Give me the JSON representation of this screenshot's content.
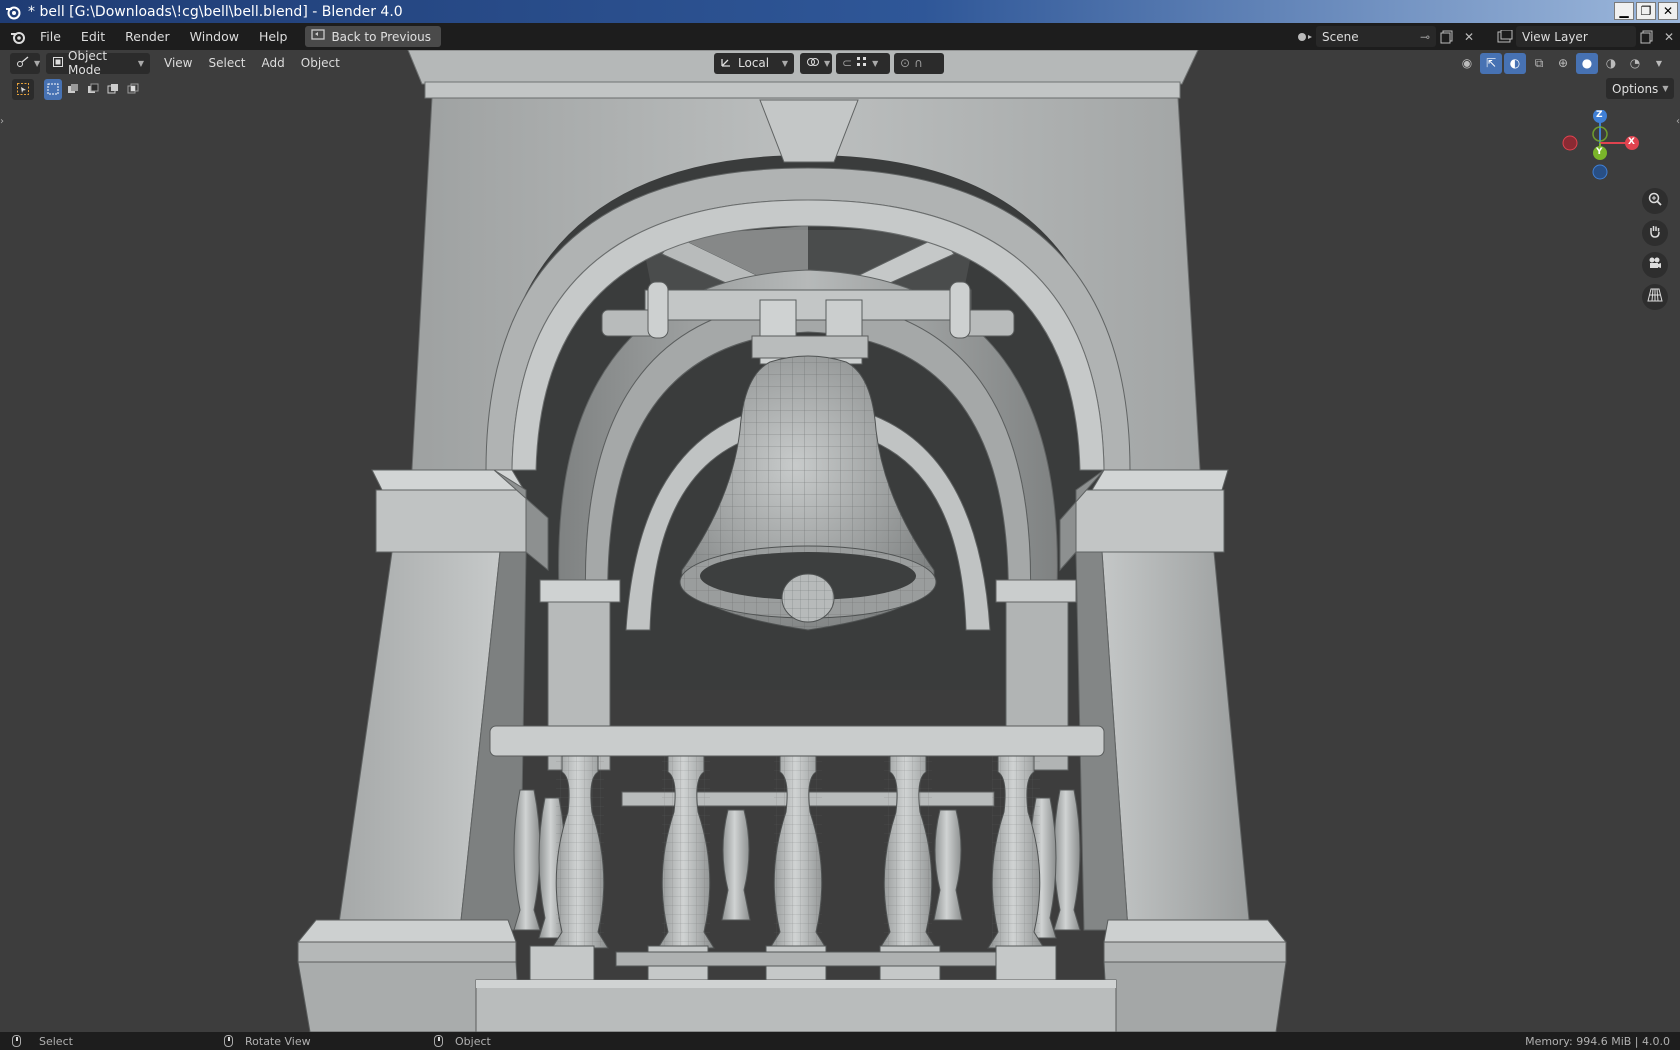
{
  "window": {
    "title": "* bell [G:\\Downloads\\!cg\\bell\\bell.blend] - Blender 4.0",
    "buttons": {
      "minimize": "▁",
      "restore": "❐",
      "close": "✕"
    }
  },
  "topbar": {
    "menus": [
      "File",
      "Edit",
      "Render",
      "Window",
      "Help"
    ],
    "back_label": "Back to Previous",
    "scene_value": "Scene",
    "view_layer_value": "View Layer"
  },
  "viewport_header": {
    "mode": "Object Mode",
    "menus": [
      "View",
      "Select",
      "Add",
      "Object"
    ],
    "transform_orientation": "Local",
    "options_label": "Options"
  },
  "gizmo": {
    "z": "Z",
    "y": "Y",
    "x": "X",
    "colors": {
      "x": "#e0434f",
      "y": "#7ab52a",
      "z": "#3f7fd6"
    }
  },
  "navigation": [
    "zoom-icon",
    "hand-icon",
    "camera-icon",
    "grid-icon"
  ],
  "statusbar": {
    "left_action": "Select",
    "middle_action": "Rotate View",
    "right_action": "Object",
    "memory": "Memory: 994.6 MiB | 4.0.0"
  },
  "colors": {
    "accent": "#4772b3",
    "viewport_bg": "#3d3d3d",
    "header_bg": "#1d1d1d"
  }
}
